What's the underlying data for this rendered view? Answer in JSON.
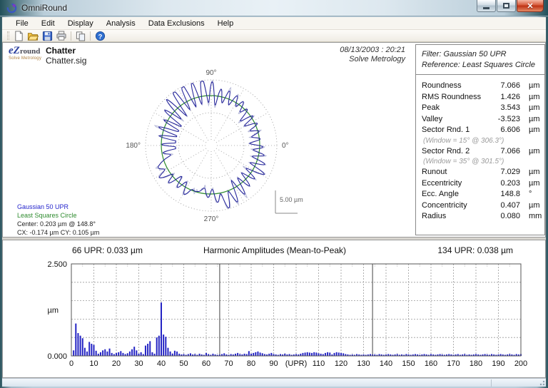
{
  "window": {
    "title": "OmniRound",
    "buttons": [
      "minimize",
      "maximize",
      "close"
    ]
  },
  "menu": {
    "items": [
      "File",
      "Edit",
      "Display",
      "Analysis",
      "Data Exclusions",
      "Help"
    ]
  },
  "toolbar": {
    "groups": [
      [
        "new",
        "open",
        "save",
        "print"
      ],
      [
        "copy"
      ],
      [
        "help"
      ]
    ]
  },
  "header": {
    "logo_ez": "eZ",
    "logo_round": "round",
    "logo_sub": "Solve Metrology",
    "doc_title": "Chatter",
    "doc_file": "Chatter.sig",
    "datetime": "08/13/2003 : 20:21",
    "vendor": "Solve Metrology"
  },
  "polar": {
    "tick_labels": {
      "right": "0°",
      "top": "90°",
      "left": "180°",
      "bottom": "270°"
    },
    "scale_label": "5.00 µm",
    "legend": {
      "filter": "Gaussian 50 UPR",
      "reference": "Least Squares Circle",
      "center": "Center: 0.203 µm @ 148.8°",
      "cxcy": "CX: -0.174 µm   CY: 0.105 µm"
    },
    "colors": {
      "filtered": "#22229a",
      "raw": "#b7bad8",
      "reference": "#2e8b2e",
      "grid": "#9a9a9a"
    }
  },
  "stats": {
    "filter_line": "Filter:   Gaussian 50 UPR",
    "reference_line": "Reference:   Least Squares Circle",
    "rows": [
      {
        "label": "Roundness",
        "value": "7.066",
        "unit": "µm"
      },
      {
        "label": "RMS Roundness",
        "value": "1.426",
        "unit": "µm"
      },
      {
        "label": "Peak",
        "value": "3.543",
        "unit": "µm"
      },
      {
        "label": "Valley",
        "value": "-3.523",
        "unit": "µm"
      },
      {
        "label": "Sector Rnd. 1",
        "value": "6.606",
        "unit": "µm",
        "note": "(Window = 15°  @ 306.3°)"
      },
      {
        "label": "Sector Rnd. 2",
        "value": "7.066",
        "unit": "µm",
        "note": "(Window = 35°  @ 301.5°)"
      },
      {
        "label": "Runout",
        "value": "7.029",
        "unit": "µm"
      },
      {
        "label": "Eccentricity",
        "value": "0.203",
        "unit": "µm"
      },
      {
        "label": "Ecc. Angle",
        "value": "148.8",
        "unit": "°"
      },
      {
        "label": "Concentricity",
        "value": "0.407",
        "unit": "µm"
      },
      {
        "label": "Radius",
        "value": "0.080",
        "unit": "mm"
      }
    ]
  },
  "chart_data": [
    {
      "type": "bar",
      "title": "Harmonic Amplitudes (Mean-to-Peak)",
      "ylabel": "µm",
      "ylim": [
        0,
        2.5
      ],
      "ytick_labels": [
        "2.500",
        "0.000"
      ],
      "xlim": [
        0,
        200
      ],
      "xtick_labels": [
        "0",
        "10",
        "20",
        "30",
        "40",
        "50",
        "60",
        "70",
        "80",
        "90",
        "(UPR)",
        "110",
        "120",
        "130",
        "140",
        "150",
        "160",
        "170",
        "180",
        "190",
        "200"
      ],
      "bar_color": "#2424c4",
      "markers": [
        {
          "upr": 66,
          "label": "66 UPR:  0.033 µm"
        },
        {
          "upr": 134,
          "label": "134 UPR:  0.038 µm"
        }
      ],
      "values": [
        0.15,
        0.88,
        0.62,
        0.55,
        0.48,
        0.22,
        0.12,
        0.38,
        0.33,
        0.3,
        0.14,
        0.06,
        0.1,
        0.15,
        0.18,
        0.12,
        0.2,
        0.08,
        0.05,
        0.08,
        0.1,
        0.13,
        0.08,
        0.05,
        0.07,
        0.12,
        0.18,
        0.25,
        0.15,
        0.06,
        0.1,
        0.05,
        0.28,
        0.33,
        0.4,
        0.1,
        0.06,
        0.5,
        0.55,
        1.45,
        0.58,
        0.52,
        0.22,
        0.12,
        0.06,
        0.14,
        0.12,
        0.06,
        0.04,
        0.05,
        0.03,
        0.05,
        0.07,
        0.04,
        0.05,
        0.03,
        0.06,
        0.04,
        0.03,
        0.08,
        0.05,
        0.03,
        0.06,
        0.04,
        0.03,
        0.033,
        0.05,
        0.07,
        0.04,
        0.03,
        0.05,
        0.04,
        0.06,
        0.08,
        0.05,
        0.04,
        0.06,
        0.05,
        0.13,
        0.06,
        0.08,
        0.1,
        0.12,
        0.09,
        0.07,
        0.05,
        0.04,
        0.06,
        0.08,
        0.05,
        0.04,
        0.03,
        0.05,
        0.04,
        0.06,
        0.04,
        0.05,
        0.03,
        0.04,
        0.05,
        0.04,
        0.06,
        0.08,
        0.09,
        0.1,
        0.09,
        0.08,
        0.1,
        0.09,
        0.07,
        0.06,
        0.05,
        0.08,
        0.1,
        0.09,
        0.04,
        0.08,
        0.1,
        0.09,
        0.08,
        0.07,
        0.05,
        0.04,
        0.03,
        0.04,
        0.03,
        0.05,
        0.04,
        0.03,
        0.04,
        0.03,
        0.04,
        0.05,
        0.038,
        0.04,
        0.03,
        0.05,
        0.04,
        0.03,
        0.04,
        0.05,
        0.04,
        0.03,
        0.04,
        0.05,
        0.03,
        0.04,
        0.03,
        0.05,
        0.04,
        0.03,
        0.04,
        0.05,
        0.04,
        0.03,
        0.04,
        0.05,
        0.04,
        0.03,
        0.05,
        0.04,
        0.03,
        0.04,
        0.05,
        0.04,
        0.03,
        0.04,
        0.05,
        0.04,
        0.03,
        0.04,
        0.05,
        0.03,
        0.04,
        0.05,
        0.03,
        0.04,
        0.03,
        0.04,
        0.05,
        0.04,
        0.03,
        0.04,
        0.05,
        0.04,
        0.03,
        0.05,
        0.04,
        0.03,
        0.04,
        0.05,
        0.04,
        0.03,
        0.04,
        0.05,
        0.04,
        0.03,
        0.05,
        0.04,
        0.05
      ]
    },
    {
      "type": "polar-profile",
      "title": "Roundness polar plot",
      "angle_labels": [
        "0°",
        "90°",
        "180°",
        "270°"
      ],
      "scale_per_division": "5.00 µm",
      "reference": "Least Squares Circle",
      "filter": "Gaussian 50 UPR",
      "dominant_harmonic_upr": 40,
      "roundness_um": 7.066,
      "rms_roundness_um": 1.426
    }
  ]
}
